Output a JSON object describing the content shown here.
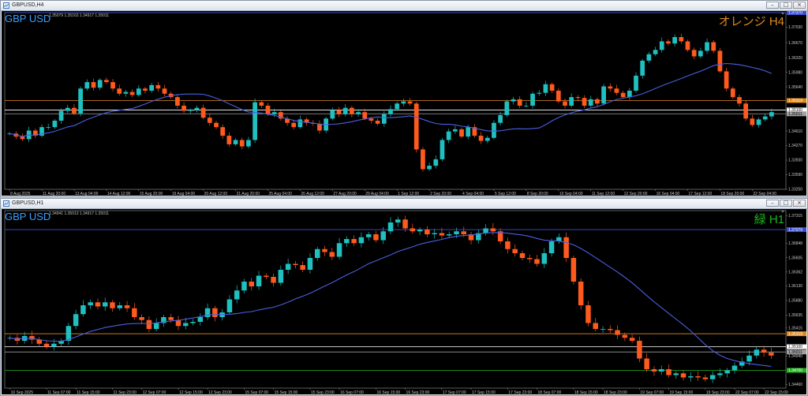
{
  "windows": [
    {
      "title": "GBPUSD,H4",
      "symbol": "GBP USD",
      "ohlc": "1.35079 1.35163 1.34917 1.35011",
      "badge": "オレンジ H4",
      "badge_color": "#e08a1e",
      "price_ticks": [
        "1.37370",
        "1.37030",
        "1.36670",
        "1.36320",
        "1.35980",
        "1.35640",
        "1.35319",
        "1.35100",
        "1.35011",
        "1.34610",
        "1.34270",
        "1.33930",
        "1.33590",
        "1.33250"
      ],
      "highlight_ticks": {
        "1.37370": "#3a4fd8",
        "1.35319": "#e08a1e",
        "1.35100": "#ffffff",
        "1.35011": "#a0a0a0"
      },
      "time_ticks": [
        "8 Aug 2025",
        "11 Aug 20:00",
        "13 Aug 04:00",
        "14 Aug 12:00",
        "15 Aug 20:00",
        "19 Aug 04:00",
        "20 Aug 12:00",
        "21 Aug 20:00",
        "25 Aug 04:00",
        "26 Aug 12:00",
        "27 Aug 20:00",
        "29 Aug 04:00",
        "1 Sep 12:00",
        "2 Sep 20:00",
        "4 Sep 04:00",
        "5 Sep 12:00",
        "8 Sep 20:00",
        "10 Sep 04:00",
        "11 Sep 12:00",
        "12 Sep 20:00",
        "16 Sep 04:00",
        "17 Sep 12:00",
        "18 Sep 20:00",
        "22 Sep 04:00"
      ],
      "chart_data": {
        "type": "candlestick",
        "ylim": [
          1.3325,
          1.3737
        ],
        "horizontal_lines": [
          {
            "price": 1.3737,
            "color": "#3a4fd8"
          },
          {
            "price": 1.35319,
            "color": "#e08a1e"
          },
          {
            "price": 1.351,
            "color": "#ffffff"
          },
          {
            "price": 1.35011,
            "color": "#a0a0a0"
          }
        ],
        "ma_color": "#4a5fe0",
        "up_color": "#20c0c0",
        "down_color": "#ff5a1e",
        "closes": [
          1.3455,
          1.3448,
          1.3442,
          1.3462,
          1.345,
          1.347,
          1.347,
          1.3485,
          1.3508,
          1.3515,
          1.3502,
          1.356,
          1.3575,
          1.3562,
          1.358,
          1.3575,
          1.356,
          1.3548,
          1.3552,
          1.3545,
          1.356,
          1.3555,
          1.3568,
          1.356,
          1.3548,
          1.354,
          1.352,
          1.3508,
          1.351,
          1.3515,
          1.3492,
          1.348,
          1.347,
          1.345,
          1.343,
          1.344,
          1.3425,
          1.344,
          1.3528,
          1.352,
          1.35,
          1.3505,
          1.349,
          1.348,
          1.347,
          1.3488,
          1.348,
          1.3478,
          1.3462,
          1.349,
          1.351,
          1.35,
          1.3515,
          1.35,
          1.3505,
          1.349,
          1.3485,
          1.3478,
          1.35,
          1.3512,
          1.3525,
          1.353,
          1.3525,
          1.3418,
          1.3372,
          1.338,
          1.3395,
          1.344,
          1.346,
          1.3465,
          1.3448,
          1.347,
          1.345,
          1.3438,
          1.3445,
          1.348,
          1.3498,
          1.353,
          1.3535,
          1.352,
          1.352,
          1.3548,
          1.355,
          1.357,
          1.3555,
          1.353,
          1.352,
          1.354,
          1.3538,
          1.352,
          1.3535,
          1.3525,
          1.3565,
          1.356,
          1.355,
          1.354,
          1.3555,
          1.359,
          1.3625,
          1.364,
          1.365,
          1.367,
          1.3665,
          1.368,
          1.367,
          1.365,
          1.3635,
          1.3648,
          1.3668,
          1.3648,
          1.36,
          1.356,
          1.354,
          1.3525,
          1.349,
          1.3475,
          1.3488,
          1.3495,
          1.3505
        ]
      },
      "time_axis_bar_index": [
        0,
        5,
        10,
        15,
        20,
        25,
        30,
        35,
        40,
        45,
        50,
        55,
        60,
        65,
        70,
        75,
        80,
        85,
        90,
        95,
        100,
        105,
        110,
        115
      ]
    },
    {
      "title": "GBPUSD,H1",
      "symbol": "GBP USD",
      "ohlc": "1.34941 1.35013 1.34917 1.35011",
      "badge": "緑 H1",
      "badge_color": "#1fb41f",
      "price_ticks": [
        "1.37315",
        "1.37079",
        "1.36848",
        "1.36605",
        "1.36362",
        "1.36130",
        "1.35880",
        "1.35635",
        "1.35415",
        "1.35319",
        "1.35100",
        "1.35011",
        "1.34940",
        "1.34700",
        "1.34460"
      ],
      "highlight_ticks": {
        "1.37079": "#3a4fd8",
        "1.35319": "#e08a1e",
        "1.35100": "#ffffff",
        "1.35011": "#a0a0a0",
        "1.34700": "#1fb41f"
      },
      "time_ticks": [
        "10 Sep 2025",
        "11 Sep 07:00",
        "11 Sep 15:00",
        "11 Sep 23:00",
        "12 Sep 07:00",
        "12 Sep 15:00",
        "12 Sep 23:00",
        "15 Sep 07:00",
        "15 Sep 15:00",
        "15 Sep 23:00",
        "16 Sep 07:00",
        "16 Sep 15:00",
        "16 Sep 23:00",
        "17 Sep 07:00",
        "17 Sep 15:00",
        "17 Sep 23:00",
        "18 Sep 07:00",
        "18 Sep 15:00",
        "18 Sep 23:00",
        "19 Sep 07:00",
        "19 Sep 15:00",
        "19 Sep 23:00",
        "22 Sep 07:00",
        "22 Sep 15:00"
      ],
      "chart_data": {
        "type": "candlestick",
        "ylim": [
          1.344,
          1.374
        ],
        "horizontal_lines": [
          {
            "price": 1.37079,
            "color": "#3a4fd8"
          },
          {
            "price": 1.35319,
            "color": "#e08a1e"
          },
          {
            "price": 1.351,
            "color": "#ffffff"
          },
          {
            "price": 1.35011,
            "color": "#a0a0a0"
          },
          {
            "price": 1.347,
            "color": "#1fb41f"
          }
        ],
        "ma_color": "#4a5fe0",
        "up_color": "#20c0c0",
        "down_color": "#ff5a1e",
        "closes": [
          1.3525,
          1.352,
          1.3528,
          1.3522,
          1.3515,
          1.351,
          1.3515,
          1.352,
          1.3545,
          1.3565,
          1.358,
          1.3585,
          1.3578,
          1.3585,
          1.3575,
          1.358,
          1.3575,
          1.356,
          1.3555,
          1.354,
          1.355,
          1.356,
          1.3555,
          1.3545,
          1.355,
          1.3552,
          1.356,
          1.3575,
          1.356,
          1.3568,
          1.359,
          1.3605,
          1.362,
          1.3612,
          1.363,
          1.3628,
          1.3618,
          1.364,
          1.365,
          1.3648,
          1.364,
          1.366,
          1.3675,
          1.367,
          1.3662,
          1.3685,
          1.3692,
          1.3685,
          1.3695,
          1.37,
          1.369,
          1.3705,
          1.372,
          1.3725,
          1.371,
          1.3705,
          1.3708,
          1.37,
          1.3702,
          1.3698,
          1.37,
          1.3705,
          1.37,
          1.369,
          1.3702,
          1.371,
          1.3705,
          1.3688,
          1.3675,
          1.3668,
          1.366,
          1.3658,
          1.365,
          1.3668,
          1.3688,
          1.3695,
          1.366,
          1.362,
          1.358,
          1.355,
          1.354,
          1.354,
          1.3538,
          1.353,
          1.3525,
          1.352,
          1.349,
          1.3472,
          1.3468,
          1.3472,
          1.3462,
          1.3465,
          1.3458,
          1.346,
          1.3458,
          1.3455,
          1.3462,
          1.3465,
          1.347,
          1.3478,
          1.3485,
          1.3495,
          1.3505,
          1.35,
          1.3495
        ]
      },
      "time_axis_bar_index": [
        0,
        5,
        9,
        14,
        18,
        23,
        27,
        32,
        36,
        41,
        45,
        50,
        54,
        59,
        63,
        68,
        72,
        77,
        81,
        86,
        90,
        95,
        99,
        103
      ]
    }
  ]
}
